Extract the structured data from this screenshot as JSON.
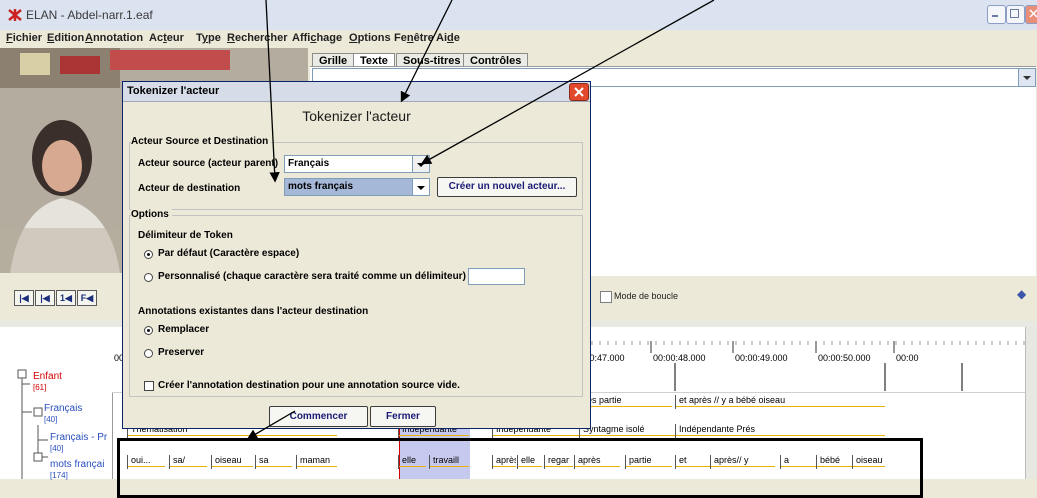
{
  "window": {
    "title": "ELAN - Abdel-narr.1.eaf"
  },
  "menu": [
    {
      "label": "Fichier",
      "u": "F",
      "rest": "ichier"
    },
    {
      "label": "Edition",
      "u": "E",
      "rest": "dition"
    },
    {
      "label": "Annotation",
      "u": "A",
      "rest": "nnotation"
    },
    {
      "label": "Acteur",
      "u": "",
      "rest": "Acteur"
    },
    {
      "label": "Type",
      "u": "",
      "rest": "Type"
    },
    {
      "label": "Rechercher",
      "u": "R",
      "rest": "echercher"
    },
    {
      "label": "Affichage",
      "u": "",
      "rest": "Affichage"
    },
    {
      "label": "Options",
      "u": "O",
      "rest": "ptions"
    },
    {
      "label": "Fenêtre",
      "u": "",
      "rest": "Fenêtre"
    },
    {
      "label": "Aide",
      "u": "",
      "rest": "Aide"
    }
  ],
  "tabs": [
    "Grille",
    "Texte",
    "Sous-titres",
    "Contrôles"
  ],
  "active_tab": "Texte",
  "controls": {
    "loop_label": "Mode de boucle",
    "loop_checked": false
  },
  "ruler": {
    "start_label": "00",
    "ticks": [
      "00:00:46.000",
      "00:00:47.000",
      "00:00:48.000",
      "00:00:49.000",
      "00:00:50.000",
      "00:00"
    ]
  },
  "tiers": [
    {
      "name": "Enfant",
      "count": "[61]",
      "color": "#d40000"
    },
    {
      "name": "Français",
      "count": "[40]",
      "color": "#2a4fc0"
    },
    {
      "name": "Français - Pr",
      "count": "[40]",
      "color": "#2a4fc0"
    },
    {
      "name": "mots françai",
      "count": "[174]",
      "color": "#2a4fc0"
    }
  ],
  "annotations": {
    "francais": [
      {
        "text": "ès partie",
        "start": 471,
        "end": 560
      },
      {
        "text": "et après // y a bébé oiseau",
        "start": 563,
        "end": 773
      }
    ],
    "francais_pr": [
      {
        "text": "Thématisation",
        "start": 15,
        "end": 225
      },
      {
        "text": "Indépendante",
        "start": 286,
        "end": 357
      },
      {
        "text": "Indépendante",
        "start": 380,
        "end": 467
      },
      {
        "text": "Syntagme isolé",
        "start": 467,
        "end": 563
      },
      {
        "text": "Indépendante Prés",
        "start": 563,
        "end": 773
      }
    ],
    "mots": [
      {
        "text": "oui...",
        "start": 15,
        "end": 53
      },
      {
        "text": "sa/",
        "start": 57,
        "end": 95
      },
      {
        "text": "oiseau",
        "start": 99,
        "end": 141
      },
      {
        "text": "sa",
        "start": 143,
        "end": 180
      },
      {
        "text": "maman",
        "start": 184,
        "end": 225
      },
      {
        "text": "elle",
        "start": 286,
        "end": 314
      },
      {
        "text": "travaill",
        "start": 317,
        "end": 357
      },
      {
        "text": "après",
        "start": 380,
        "end": 404
      },
      {
        "text": "elle",
        "start": 405,
        "end": 430
      },
      {
        "text": "regar",
        "start": 432,
        "end": 461
      },
      {
        "text": "après",
        "start": 462,
        "end": 508
      },
      {
        "text": "partie",
        "start": 513,
        "end": 560
      },
      {
        "text": "et",
        "start": 563,
        "end": 598
      },
      {
        "text": "après// y",
        "start": 598,
        "end": 663
      },
      {
        "text": "a",
        "start": 668,
        "end": 704
      },
      {
        "text": "bébé",
        "start": 704,
        "end": 740
      },
      {
        "text": "oiseau",
        "start": 740,
        "end": 773
      }
    ]
  },
  "dialog": {
    "title": "Tokenizer l'acteur",
    "heading": "Tokenizer l'acteur",
    "source_group": "Acteur Source et Destination",
    "source_label": "Acteur source (acteur parent)",
    "source_value": "Français",
    "dest_label": "Acteur de destination",
    "dest_value": "mots français",
    "new_tier_button": "Créer un nouvel acteur...",
    "options_group": "Options",
    "delimiter_heading": "Délimiteur de Token",
    "delimiter_default": "Par défaut (Caractère espace)",
    "delimiter_custom": "Personnalisé (chaque caractère sera traité comme un délimiteur)",
    "delimiter_custom_value": "",
    "existing_heading": "Annotations existantes dans l'acteur destination",
    "existing_replace": "Remplacer",
    "existing_preserve": "Preserver",
    "empty_checkbox": "Créer l'annotation destination pour une annotation source vide.",
    "start_button": "Commencer",
    "close_button": "Fermer"
  },
  "colors": {
    "annotation_underline": "#e7b200",
    "crosshair": "#d40000",
    "selection": "#c6c9ee"
  }
}
